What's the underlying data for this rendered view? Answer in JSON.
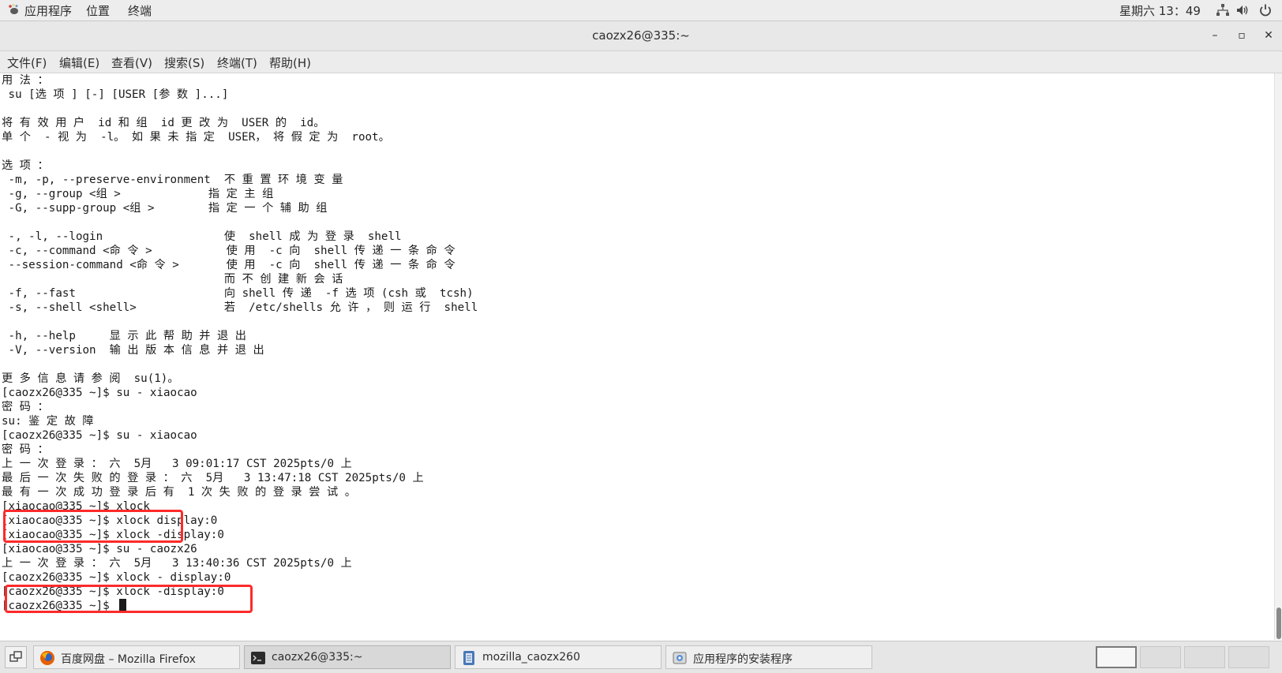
{
  "topbar": {
    "applications": "应用程序",
    "places": "位置",
    "terminal": "终端",
    "clock": "星期六 13：49",
    "apps_icon": "gnome-foot-icon",
    "network_icon": "network-icon",
    "volume_icon": "volume-icon",
    "power_icon": "power-icon"
  },
  "window": {
    "title": "caozx26@335:~",
    "minimize": "–",
    "maximize": "▫",
    "close": "✕"
  },
  "menubar": {
    "items": [
      "文件(F)",
      "编辑(E)",
      "查看(V)",
      "搜索(S)",
      "终端(T)",
      "帮助(H)"
    ]
  },
  "terminal": {
    "lines": [
      "用 法 ：",
      " su [选 项 ] [-] [USER [参 数 ]...]",
      "",
      "将 有 效 用 户  id 和 组  id 更 改 为  USER 的  id。",
      "单 个  - 视 为  -l。 如 果 未 指 定  USER， 将 假 定 为  root。",
      "",
      "选 项 ：",
      " -m, -p, --preserve-environment  不 重 置 环 境 变 量",
      " -g, --group <组 >             指 定 主 组",
      " -G, --supp-group <组 >        指 定 一 个 辅 助 组",
      "",
      " -, -l, --login                  使  shell 成 为 登 录  shell",
      " -c, --command <命 令 >           使 用  -c 向  shell 传 递 一 条 命 令",
      " --session-command <命 令 >       使 用  -c 向  shell 传 递 一 条 命 令",
      "                                 而 不 创 建 新 会 话",
      " -f, --fast                      向 shell 传 递  -f 选 项 (csh 或  tcsh)",
      " -s, --shell <shell>             若  /etc/shells 允 许 ， 则 运 行  shell",
      "",
      " -h, --help     显 示 此 帮 助 并 退 出",
      " -V, --version  输 出 版 本 信 息 并 退 出",
      "",
      "更 多 信 息 请 参 阅  su(1)。",
      "[caozx26@335 ~]$ su - xiaocao",
      "密 码 ：",
      "su: 鉴 定 故 障",
      "[caozx26@335 ~]$ su - xiaocao",
      "密 码 ：",
      "上 一 次 登 录 ： 六  5月   3 09:01:17 CST 2025pts/0 上",
      "最 后 一 次 失 败 的 登 录 ： 六  5月   3 13:47:18 CST 2025pts/0 上",
      "最 有 一 次 成 功 登 录 后 有  1 次 失 败 的 登 录 尝 试 。",
      "[xiaocao@335 ~]$ xlock",
      "[xiaocao@335 ~]$ xlock display:0",
      "[xiaocao@335 ~]$ xlock -display:0",
      "[xiaocao@335 ~]$ su - caozx26",
      "上 一 次 登 录 ： 六  5月   3 13:40:36 CST 2025pts/0 上",
      "[caozx26@335 ~]$ xlock - display:0",
      "[caozx26@335 ~]$ xlock -display:0",
      "[caozx26@335 ~]$ "
    ]
  },
  "taskbar": {
    "tasks": [
      {
        "label": "百度网盘 – Mozilla Firefox",
        "icon": "firefox-icon"
      },
      {
        "label": "caozx26@335:~",
        "icon": "terminal-icon"
      },
      {
        "label": "mozilla_caozx260",
        "icon": "file-manager-icon"
      },
      {
        "label": "应用程序的安装程序",
        "icon": "software-installer-icon"
      }
    ]
  },
  "colors": {
    "annotation": "#ff2a2a",
    "background": "#ffffff",
    "text": "#1a1a1a"
  }
}
